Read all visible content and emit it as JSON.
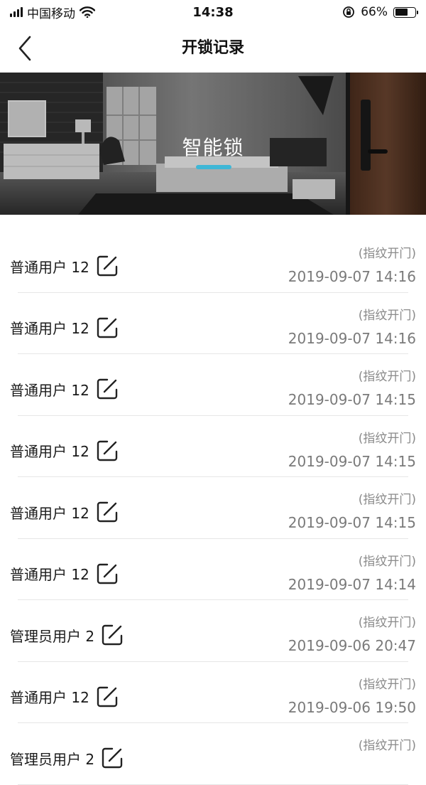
{
  "status_bar": {
    "carrier": "中国移动",
    "time": "14:38",
    "battery": "66%",
    "battery_level": 0.66
  },
  "nav": {
    "title": "开锁记录"
  },
  "banner": {
    "title": "智能锁"
  },
  "records": [
    {
      "user": "普通用户 12",
      "method": "(指纹开门)",
      "time": "2019-09-07 14:16"
    },
    {
      "user": "普通用户 12",
      "method": "(指纹开门)",
      "time": "2019-09-07 14:16"
    },
    {
      "user": "普通用户 12",
      "method": "(指纹开门)",
      "time": "2019-09-07 14:15"
    },
    {
      "user": "普通用户 12",
      "method": "(指纹开门)",
      "time": "2019-09-07 14:15"
    },
    {
      "user": "普通用户 12",
      "method": "(指纹开门)",
      "time": "2019-09-07 14:15"
    },
    {
      "user": "普通用户 12",
      "method": "(指纹开门)",
      "time": "2019-09-07 14:14"
    },
    {
      "user": "管理员用户 2",
      "method": "(指纹开门)",
      "time": "2019-09-06 20:47"
    },
    {
      "user": "普通用户 12",
      "method": "(指纹开门)",
      "time": "2019-09-06 19:50"
    },
    {
      "user": "管理员用户 2",
      "method": "(指纹开门)",
      "time": ""
    }
  ]
}
